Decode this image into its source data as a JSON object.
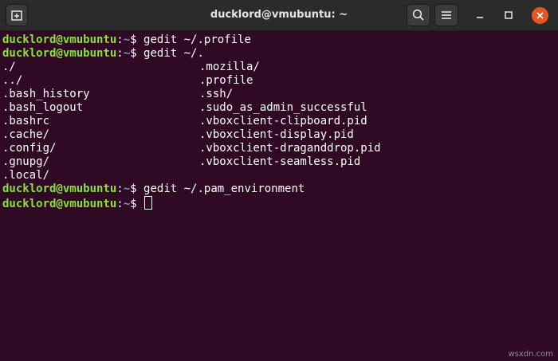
{
  "window": {
    "title": "ducklord@vmubuntu: ~",
    "buttons": {
      "new_tab_icon": "new-tab-icon",
      "search_icon": "search-icon",
      "menu_icon": "hamburger-menu-icon",
      "minimize_icon": "minimize-icon",
      "maximize_icon": "maximize-icon",
      "close_icon": "close-icon"
    }
  },
  "terminal": {
    "prompt": {
      "user_host": "ducklord@vmubuntu",
      "colon": ":",
      "path": "~",
      "dollar": "$ "
    },
    "lines": [
      {
        "type": "prompt",
        "command": "gedit ~/.profile"
      },
      {
        "type": "prompt",
        "command": "gedit ~/."
      },
      {
        "type": "output",
        "col1": "./",
        "col2": ".mozilla/"
      },
      {
        "type": "output",
        "col1": "../",
        "col2": ".profile"
      },
      {
        "type": "output",
        "col1": ".bash_history",
        "col2": ".ssh/"
      },
      {
        "type": "output",
        "col1": ".bash_logout",
        "col2": ".sudo_as_admin_successful"
      },
      {
        "type": "output",
        "col1": ".bashrc",
        "col2": ".vboxclient-clipboard.pid"
      },
      {
        "type": "output",
        "col1": ".cache/",
        "col2": ".vboxclient-display.pid"
      },
      {
        "type": "output",
        "col1": ".config/",
        "col2": ".vboxclient-draganddrop.pid"
      },
      {
        "type": "output",
        "col1": ".gnupg/",
        "col2": ".vboxclient-seamless.pid"
      },
      {
        "type": "output",
        "col1": ".local/",
        "col2": ""
      },
      {
        "type": "prompt",
        "command": "gedit ~/.pam_environment"
      },
      {
        "type": "prompt",
        "command": ""
      }
    ]
  },
  "watermark": "wsxdn.com",
  "colors": {
    "background": "#300a24",
    "titlebar": "#2b2b2b",
    "user_host": "#8ae234",
    "path": "#729fcf",
    "close_button": "#e95420"
  }
}
